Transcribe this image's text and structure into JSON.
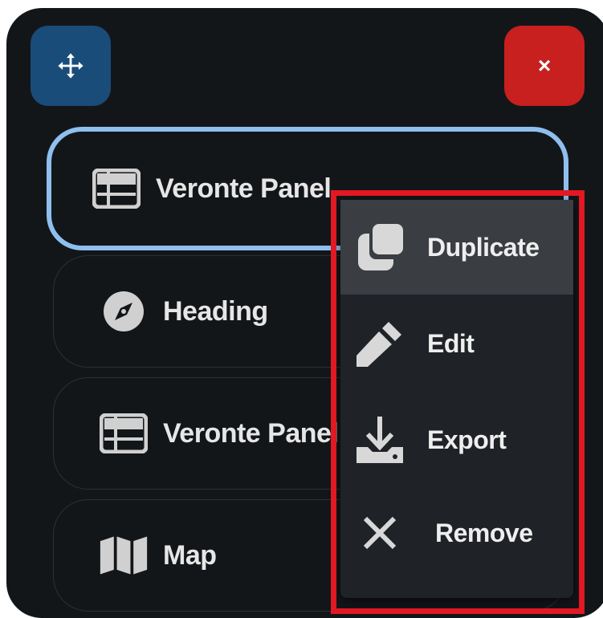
{
  "widget": {
    "close_label": "×",
    "items": [
      {
        "label": "Veronte Panel",
        "icon": "table-list-icon",
        "selected": true
      },
      {
        "label": "Heading",
        "icon": "compass-icon"
      },
      {
        "label": "Veronte Panel",
        "icon": "table-list-icon"
      },
      {
        "label": "Map",
        "icon": "map-icon"
      }
    ]
  },
  "context_menu": {
    "items": [
      {
        "label": "Duplicate",
        "icon": "duplicate-icon"
      },
      {
        "label": "Edit",
        "icon": "pencil-icon"
      },
      {
        "label": "Export",
        "icon": "download-icon"
      },
      {
        "label": "Remove",
        "icon": "close-icon"
      }
    ]
  },
  "colors": {
    "panel_bg": "#131619",
    "move_button": "#1a4c7a",
    "close_button": "#c81f1f",
    "selected_border": "#8fbfee",
    "highlight_outline": "#e21823",
    "menu_bg": "#1f2226",
    "menu_hover": "#3a3d42"
  }
}
